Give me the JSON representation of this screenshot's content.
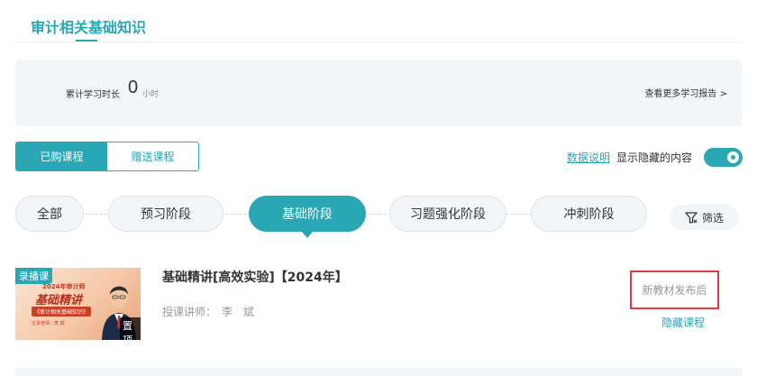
{
  "header": {
    "title": "审计相关基础知识"
  },
  "stats": {
    "label": "累计学习时长",
    "value": "0",
    "unit": "小时",
    "more_link": "查看更多学习报告 >"
  },
  "purchase_tabs": [
    {
      "label": "已购课程",
      "active": true
    },
    {
      "label": "赠送课程",
      "active": false
    }
  ],
  "data_explanation_link": "数据说明",
  "show_hidden_label": "显示隐藏的内容",
  "show_hidden_toggle_on": true,
  "stages": [
    {
      "label": "全部",
      "active": false
    },
    {
      "label": "预习阶段",
      "active": false
    },
    {
      "label": "基础阶段",
      "active": true
    },
    {
      "label": "习题强化阶段",
      "active": false
    },
    {
      "label": "冲刺阶段",
      "active": false
    }
  ],
  "filter_label": "筛选",
  "course": {
    "thumbnail": {
      "badge": "录播课",
      "year_line": "2024年审计师",
      "title": "基础精讲",
      "subtitle": "《审计相关基础知识》",
      "teacher_tag": "主讲老师：李 斌",
      "pin_label": "置顶"
    },
    "title": "基础精讲[高效实验]【2024年】",
    "teacher_label": "授课讲师：",
    "teacher_name": "李 斌",
    "status": "新教材发布后",
    "hide_link": "隐藏课程"
  },
  "colors": {
    "accent": "#2aa7b5",
    "highlight_border": "#e53a3a",
    "panel_bg": "#f3f6f8"
  }
}
